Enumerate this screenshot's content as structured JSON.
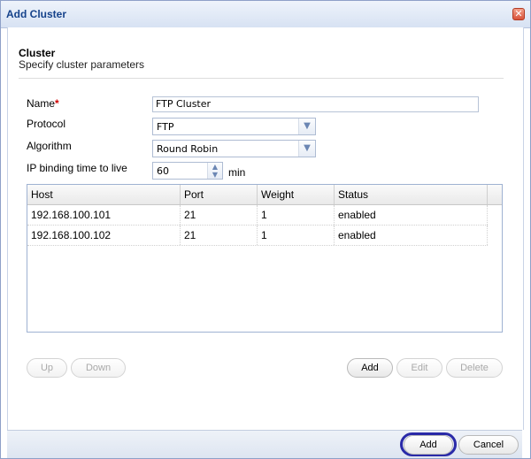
{
  "dialog": {
    "title": "Add Cluster",
    "close_icon": "close-icon"
  },
  "section": {
    "title": "Cluster",
    "subtitle": "Specify cluster parameters"
  },
  "form": {
    "name_label": "Name",
    "required_mark": "*",
    "name_value": "FTP Cluster",
    "protocol_label": "Protocol",
    "protocol_value": "FTP",
    "algorithm_label": "Algorithm",
    "algorithm_value": "Round Robin",
    "ttl_label": "IP binding time to live",
    "ttl_value": "60",
    "ttl_unit": "min"
  },
  "grid": {
    "columns": [
      "Host",
      "Port",
      "Weight",
      "Status"
    ],
    "rows": [
      [
        "192.168.100.101",
        "21",
        "1",
        "enabled"
      ],
      [
        "192.168.100.102",
        "21",
        "1",
        "enabled"
      ]
    ]
  },
  "grid_buttons": {
    "up": "Up",
    "down": "Down",
    "add": "Add",
    "edit": "Edit",
    "delete": "Delete"
  },
  "footer": {
    "add": "Add",
    "cancel": "Cancel"
  },
  "colors": {
    "accent": "#15428b",
    "focus_ring": "#2a2aa8",
    "required": "#d00000"
  }
}
